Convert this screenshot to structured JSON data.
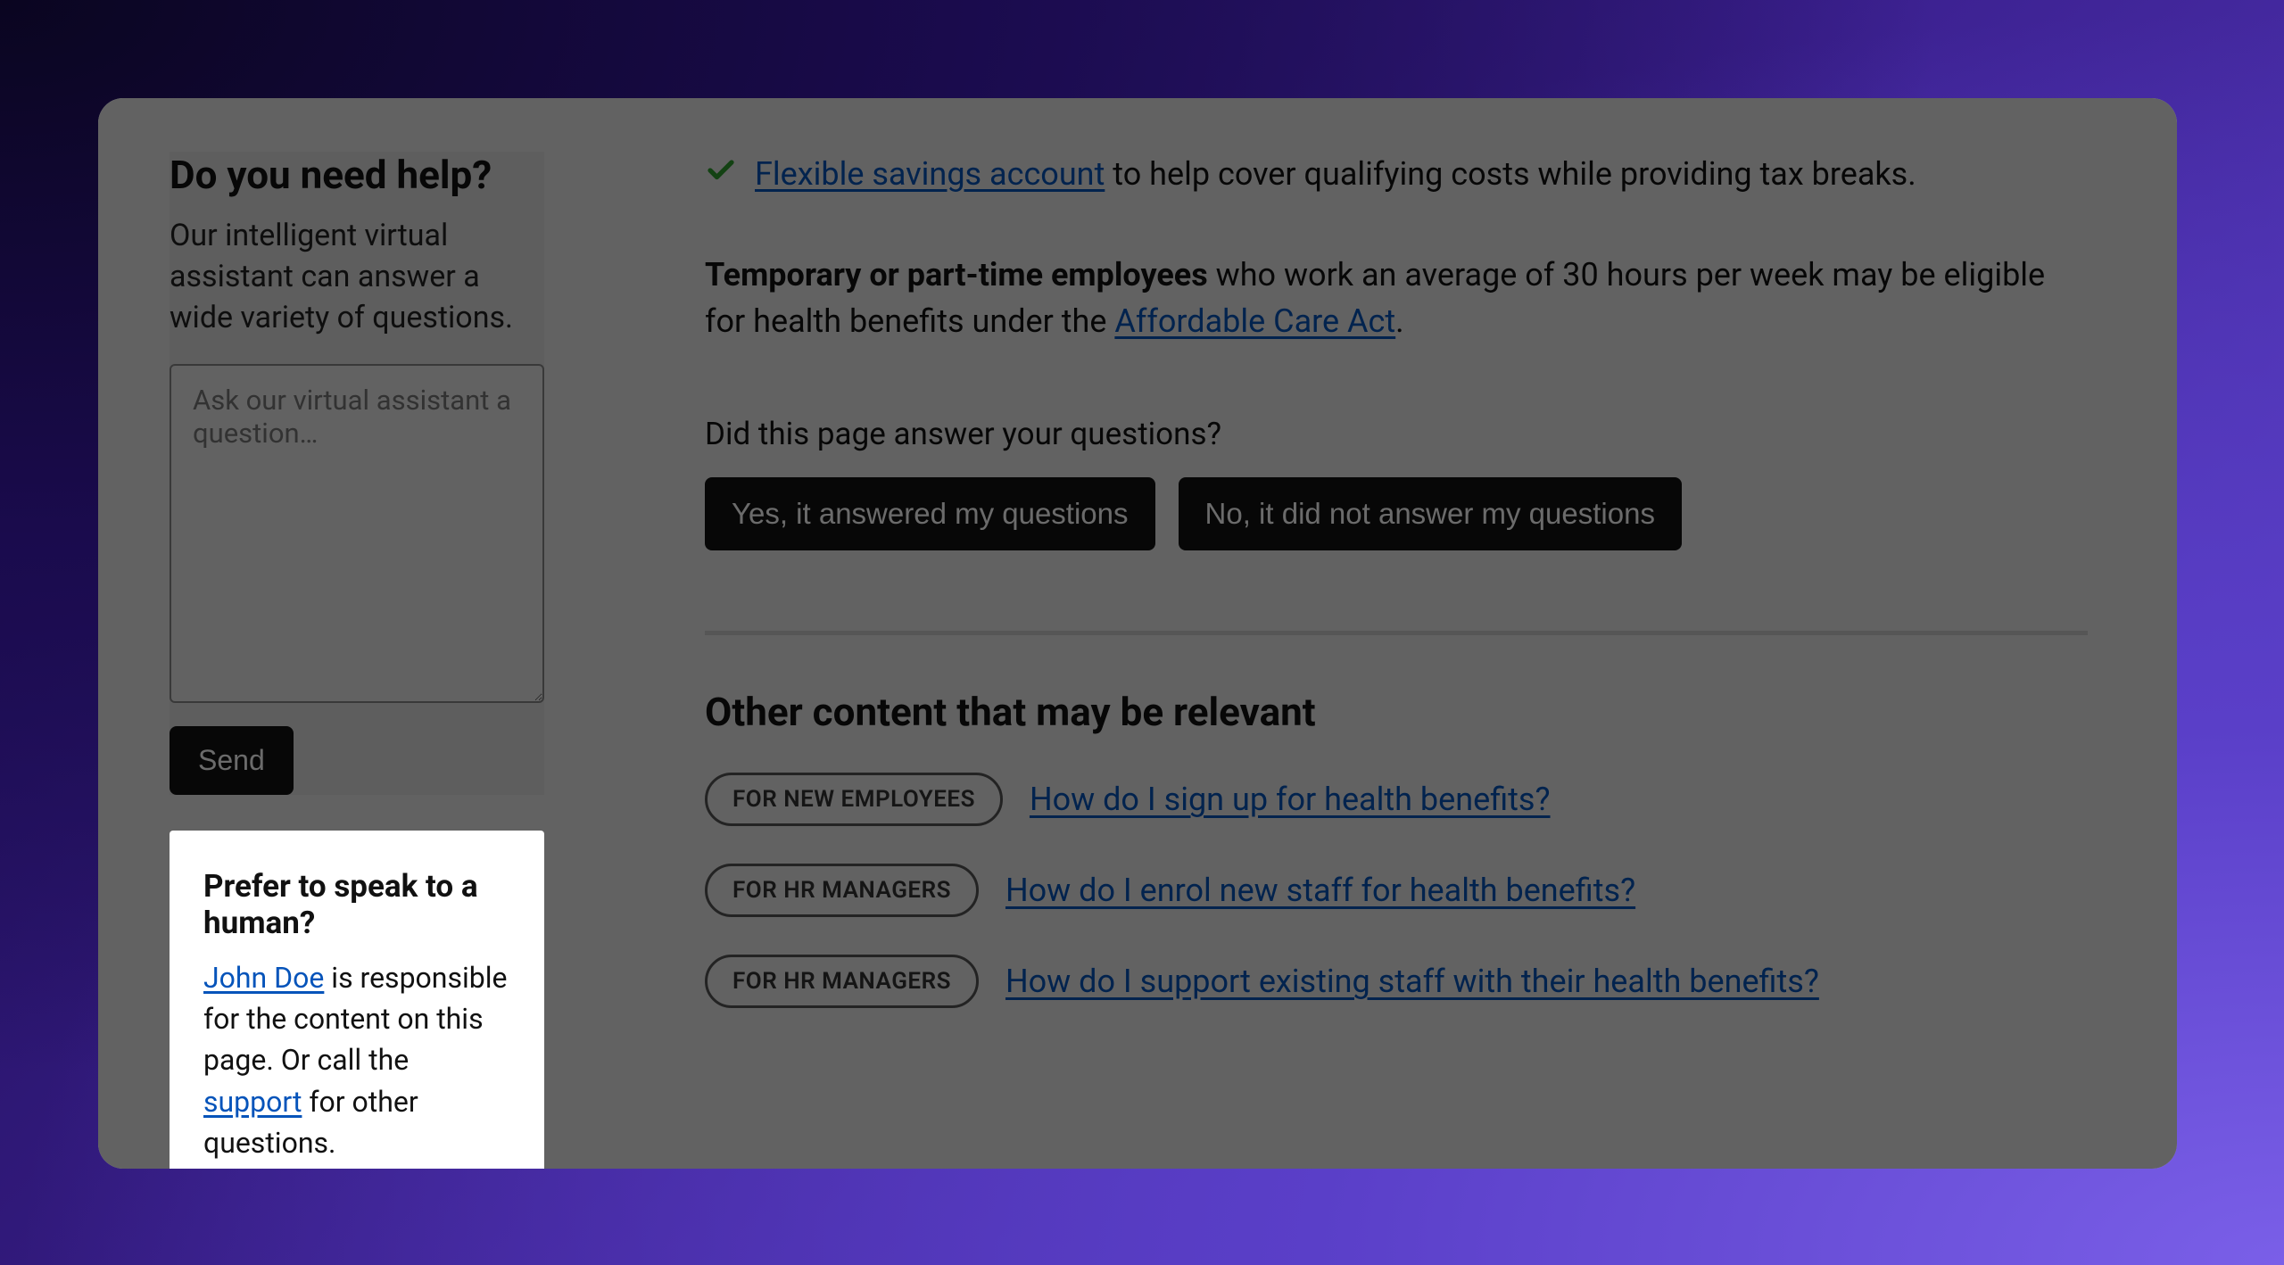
{
  "sidebar": {
    "help": {
      "title": "Do you need help?",
      "description": "Our intelligent virtual assistant can answer a wide variety of questions.",
      "placeholder": "Ask our virtual assistant a question…",
      "send_label": "Send"
    },
    "human": {
      "title": "Prefer to speak to a human?",
      "contact_name": "John Doe",
      "text_mid": " is responsible for the content on this page. Or call the ",
      "support_link": "support",
      "text_end": " for other questions."
    }
  },
  "main": {
    "benefit": {
      "link": "Flexible savings account",
      "text_after": " to help cover qualifying costs while providing tax breaks."
    },
    "eligibility": {
      "bold": "Temporary or part-time employees",
      "text_mid": " who work an average of 30 hours per week may be eligible for health benefits under the ",
      "link": "Affordable Care Act",
      "text_end": "."
    },
    "feedback": {
      "question": "Did this page answer your questions?",
      "yes_label": "Yes, it answered my questions",
      "no_label": "No, it did not answer my questions"
    },
    "related": {
      "title": "Other content that may be relevant",
      "items": [
        {
          "tag": "FOR NEW EMPLOYEES",
          "link": "How do I sign up for health benefits?"
        },
        {
          "tag": "FOR HR MANAGERS",
          "link": "How do I enrol new staff for health benefits?"
        },
        {
          "tag": "FOR HR MANAGERS",
          "link": "How do I support existing staff with their health benefits?"
        }
      ]
    }
  }
}
